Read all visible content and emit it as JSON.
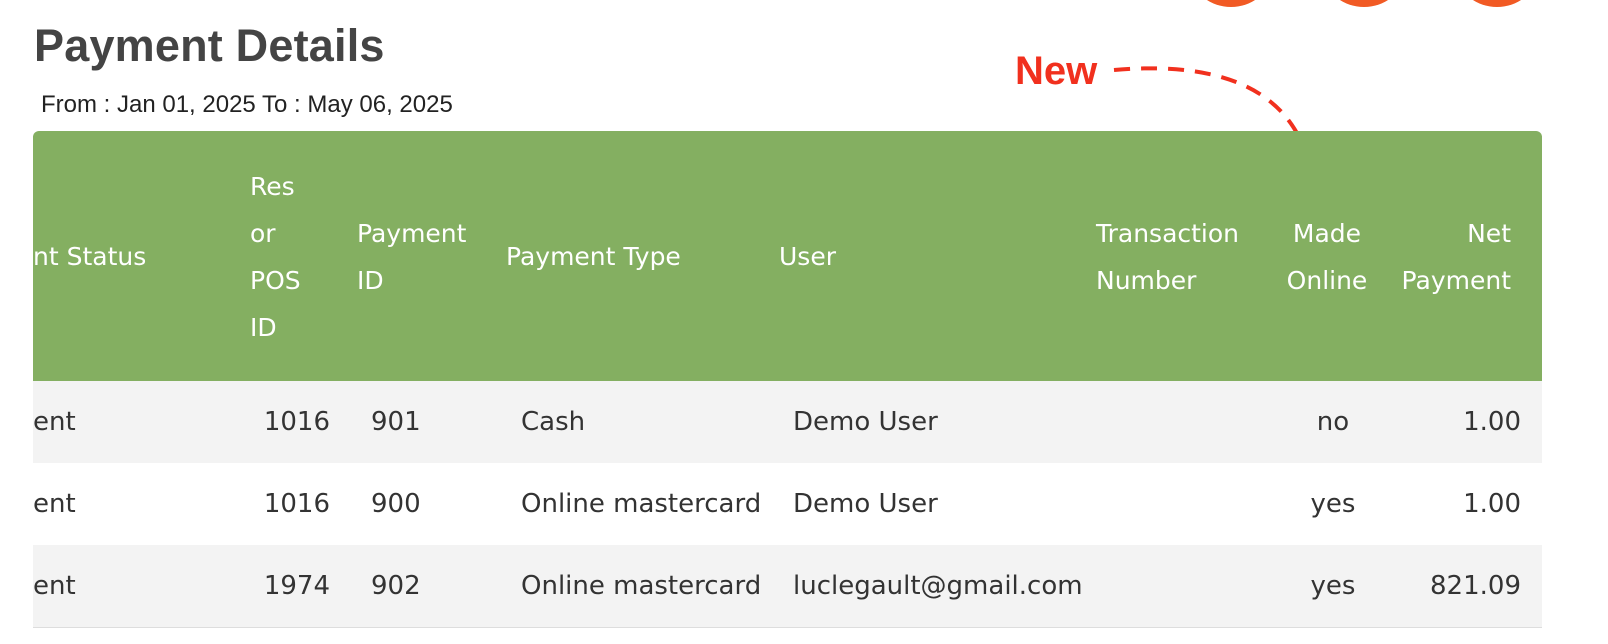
{
  "page": {
    "title": "Payment Details",
    "date_range": "From : Jan 01, 2025 To : May 06, 2025"
  },
  "annotation": {
    "label": "New",
    "color": "#f1301e"
  },
  "colors": {
    "header_bg": "#84af61",
    "accent_circles": "#f15a24"
  },
  "table": {
    "headers": {
      "status": "nt Status",
      "res_pos_id": "Res\nor\nPOS\nID",
      "payment_id": "Payment\nID",
      "payment_type": "Payment Type",
      "user": "User",
      "transaction_number": "Transaction\nNumber",
      "made_online": "Made\nOnline",
      "net_payment": "Net\nPayment"
    },
    "rows": [
      {
        "status": "ent",
        "res_pos_id": "1016",
        "payment_id": "901",
        "payment_type": "Cash",
        "user": "Demo User",
        "transaction_number": "",
        "made_online": "no",
        "net_payment": "1.00"
      },
      {
        "status": "ent",
        "res_pos_id": "1016",
        "payment_id": "900",
        "payment_type": "Online mastercard",
        "user": "Demo User",
        "transaction_number": "",
        "made_online": "yes",
        "net_payment": "1.00"
      },
      {
        "status": "ent",
        "res_pos_id": "1974",
        "payment_id": "902",
        "payment_type": "Online mastercard",
        "user": "luclegault@gmail.com",
        "transaction_number": "",
        "made_online": "yes",
        "net_payment": "821.09"
      }
    ]
  }
}
